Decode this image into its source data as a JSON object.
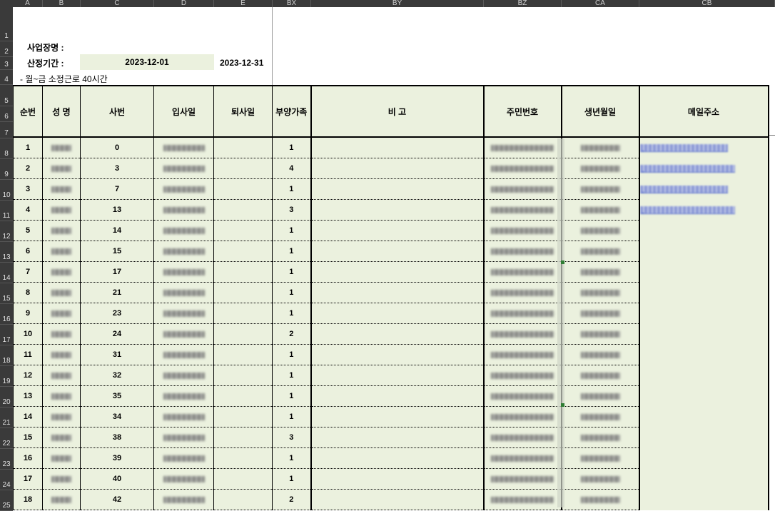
{
  "column_headers": [
    "A",
    "B",
    "C",
    "D",
    "E",
    "BX",
    "BY",
    "BZ",
    "CA",
    "CB"
  ],
  "row_numbers": [
    "1",
    "2",
    "3",
    "4",
    "5",
    "6",
    "7",
    "8",
    "9",
    "10",
    "11",
    "12",
    "13",
    "14",
    "15",
    "16",
    "17",
    "18",
    "19",
    "20",
    "21",
    "22",
    "23",
    "24",
    "25"
  ],
  "info": {
    "business_label": "사업장명 :",
    "period_label": "산정기간 :",
    "period_start": "2023-12-01",
    "period_end": "2023-12-31",
    "note": "- 월~금 소정근로 40시간"
  },
  "table": {
    "headers": [
      "순번",
      "성 명",
      "사번",
      "입사일",
      "퇴사일",
      "부양가족",
      "비 고",
      "주민번호",
      "생년월일",
      "메일주소"
    ],
    "rows": [
      {
        "no": "1",
        "emp_id": "0",
        "dependents": "1"
      },
      {
        "no": "2",
        "emp_id": "3",
        "dependents": "4"
      },
      {
        "no": "3",
        "emp_id": "7",
        "dependents": "1"
      },
      {
        "no": "4",
        "emp_id": "13",
        "dependents": "3"
      },
      {
        "no": "5",
        "emp_id": "14",
        "dependents": "1"
      },
      {
        "no": "6",
        "emp_id": "15",
        "dependents": "1"
      },
      {
        "no": "7",
        "emp_id": "17",
        "dependents": "1"
      },
      {
        "no": "8",
        "emp_id": "21",
        "dependents": "1"
      },
      {
        "no": "9",
        "emp_id": "23",
        "dependents": "1"
      },
      {
        "no": "10",
        "emp_id": "24",
        "dependents": "2"
      },
      {
        "no": "11",
        "emp_id": "31",
        "dependents": "1"
      },
      {
        "no": "12",
        "emp_id": "32",
        "dependents": "1"
      },
      {
        "no": "13",
        "emp_id": "35",
        "dependents": "1"
      },
      {
        "no": "14",
        "emp_id": "34",
        "dependents": "1"
      },
      {
        "no": "15",
        "emp_id": "38",
        "dependents": "3"
      },
      {
        "no": "16",
        "emp_id": "39",
        "dependents": "1"
      },
      {
        "no": "17",
        "emp_id": "40",
        "dependents": "1"
      },
      {
        "no": "18",
        "emp_id": "42",
        "dependents": "2"
      }
    ]
  },
  "colors": {
    "header_bg": "#3a3a3a",
    "cell_fill": "#ebf1de",
    "link": "#2a45c8",
    "marker": "#2e7d32"
  }
}
